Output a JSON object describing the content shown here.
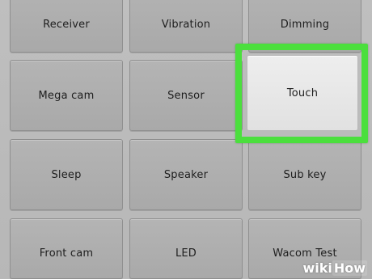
{
  "tiles": [
    {
      "label": "Receiver",
      "name": "receiver"
    },
    {
      "label": "Vibration",
      "name": "vibration"
    },
    {
      "label": "Dimming",
      "name": "dimming"
    },
    {
      "label": "Mega cam",
      "name": "mega-cam"
    },
    {
      "label": "Sensor",
      "name": "sensor"
    },
    {
      "label": "Touch",
      "name": "touch"
    },
    {
      "label": "Sleep",
      "name": "sleep"
    },
    {
      "label": "Speaker",
      "name": "speaker"
    },
    {
      "label": "Sub key",
      "name": "sub-key"
    },
    {
      "label": "Front cam",
      "name": "front-cam"
    },
    {
      "label": "LED",
      "name": "led"
    },
    {
      "label": "Wacom Test",
      "name": "wacom-test"
    }
  ],
  "highlight": {
    "target": "Touch",
    "color": "#4bdf3d"
  },
  "watermark": {
    "wiki": "wiki",
    "how": "How"
  }
}
